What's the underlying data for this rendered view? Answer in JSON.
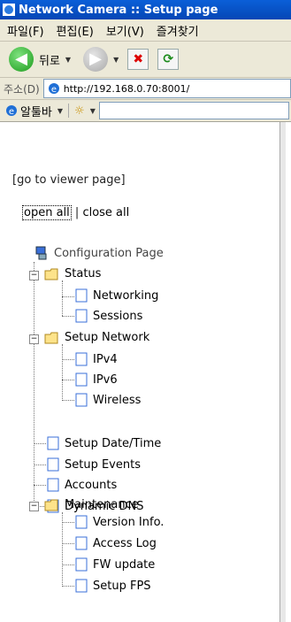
{
  "window": {
    "title": "Network Camera :: Setup page"
  },
  "menu": [
    "파일(F)",
    "편집(E)",
    "보기(V)",
    "즐겨찾기"
  ],
  "toolbar": {
    "back_label": "뒤로"
  },
  "address": {
    "label": "주소(D)",
    "url": "http://192.168.0.70:8001/"
  },
  "linkbar": {
    "label": "알툴바"
  },
  "nav": {
    "viewer_link": "[go to viewer page]",
    "open_all": "open all",
    "sep": "|",
    "close_all": "close all"
  },
  "tree": {
    "root": "Configuration Page",
    "status": "Status",
    "status_items": [
      "Networking",
      "Sessions"
    ],
    "setup_network": "Setup Network",
    "setup_network_items": [
      "IPv4",
      "IPv6",
      "Wireless"
    ],
    "top_items": [
      "Setup Date/Time",
      "Setup Events",
      "Accounts",
      "Dynamic DNS"
    ],
    "maintenance": "Maintenance",
    "maintenance_items": [
      "Version Info.",
      "Access Log",
      "FW update",
      "Setup FPS"
    ]
  }
}
